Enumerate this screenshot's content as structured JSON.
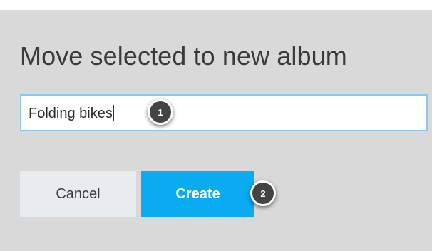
{
  "dialog": {
    "title": "Move selected to new album",
    "album_name_value": "Folding bikes",
    "cancel_label": "Cancel",
    "create_label": "Create"
  },
  "callouts": [
    {
      "number": "1"
    },
    {
      "number": "2"
    }
  ],
  "colors": {
    "dialog_background": "#d9d9d9",
    "primary_button": "#0aabf0",
    "secondary_button": "#e9ecef",
    "input_focus_border": "#8cc6e8",
    "callout_badge": "#444444"
  }
}
